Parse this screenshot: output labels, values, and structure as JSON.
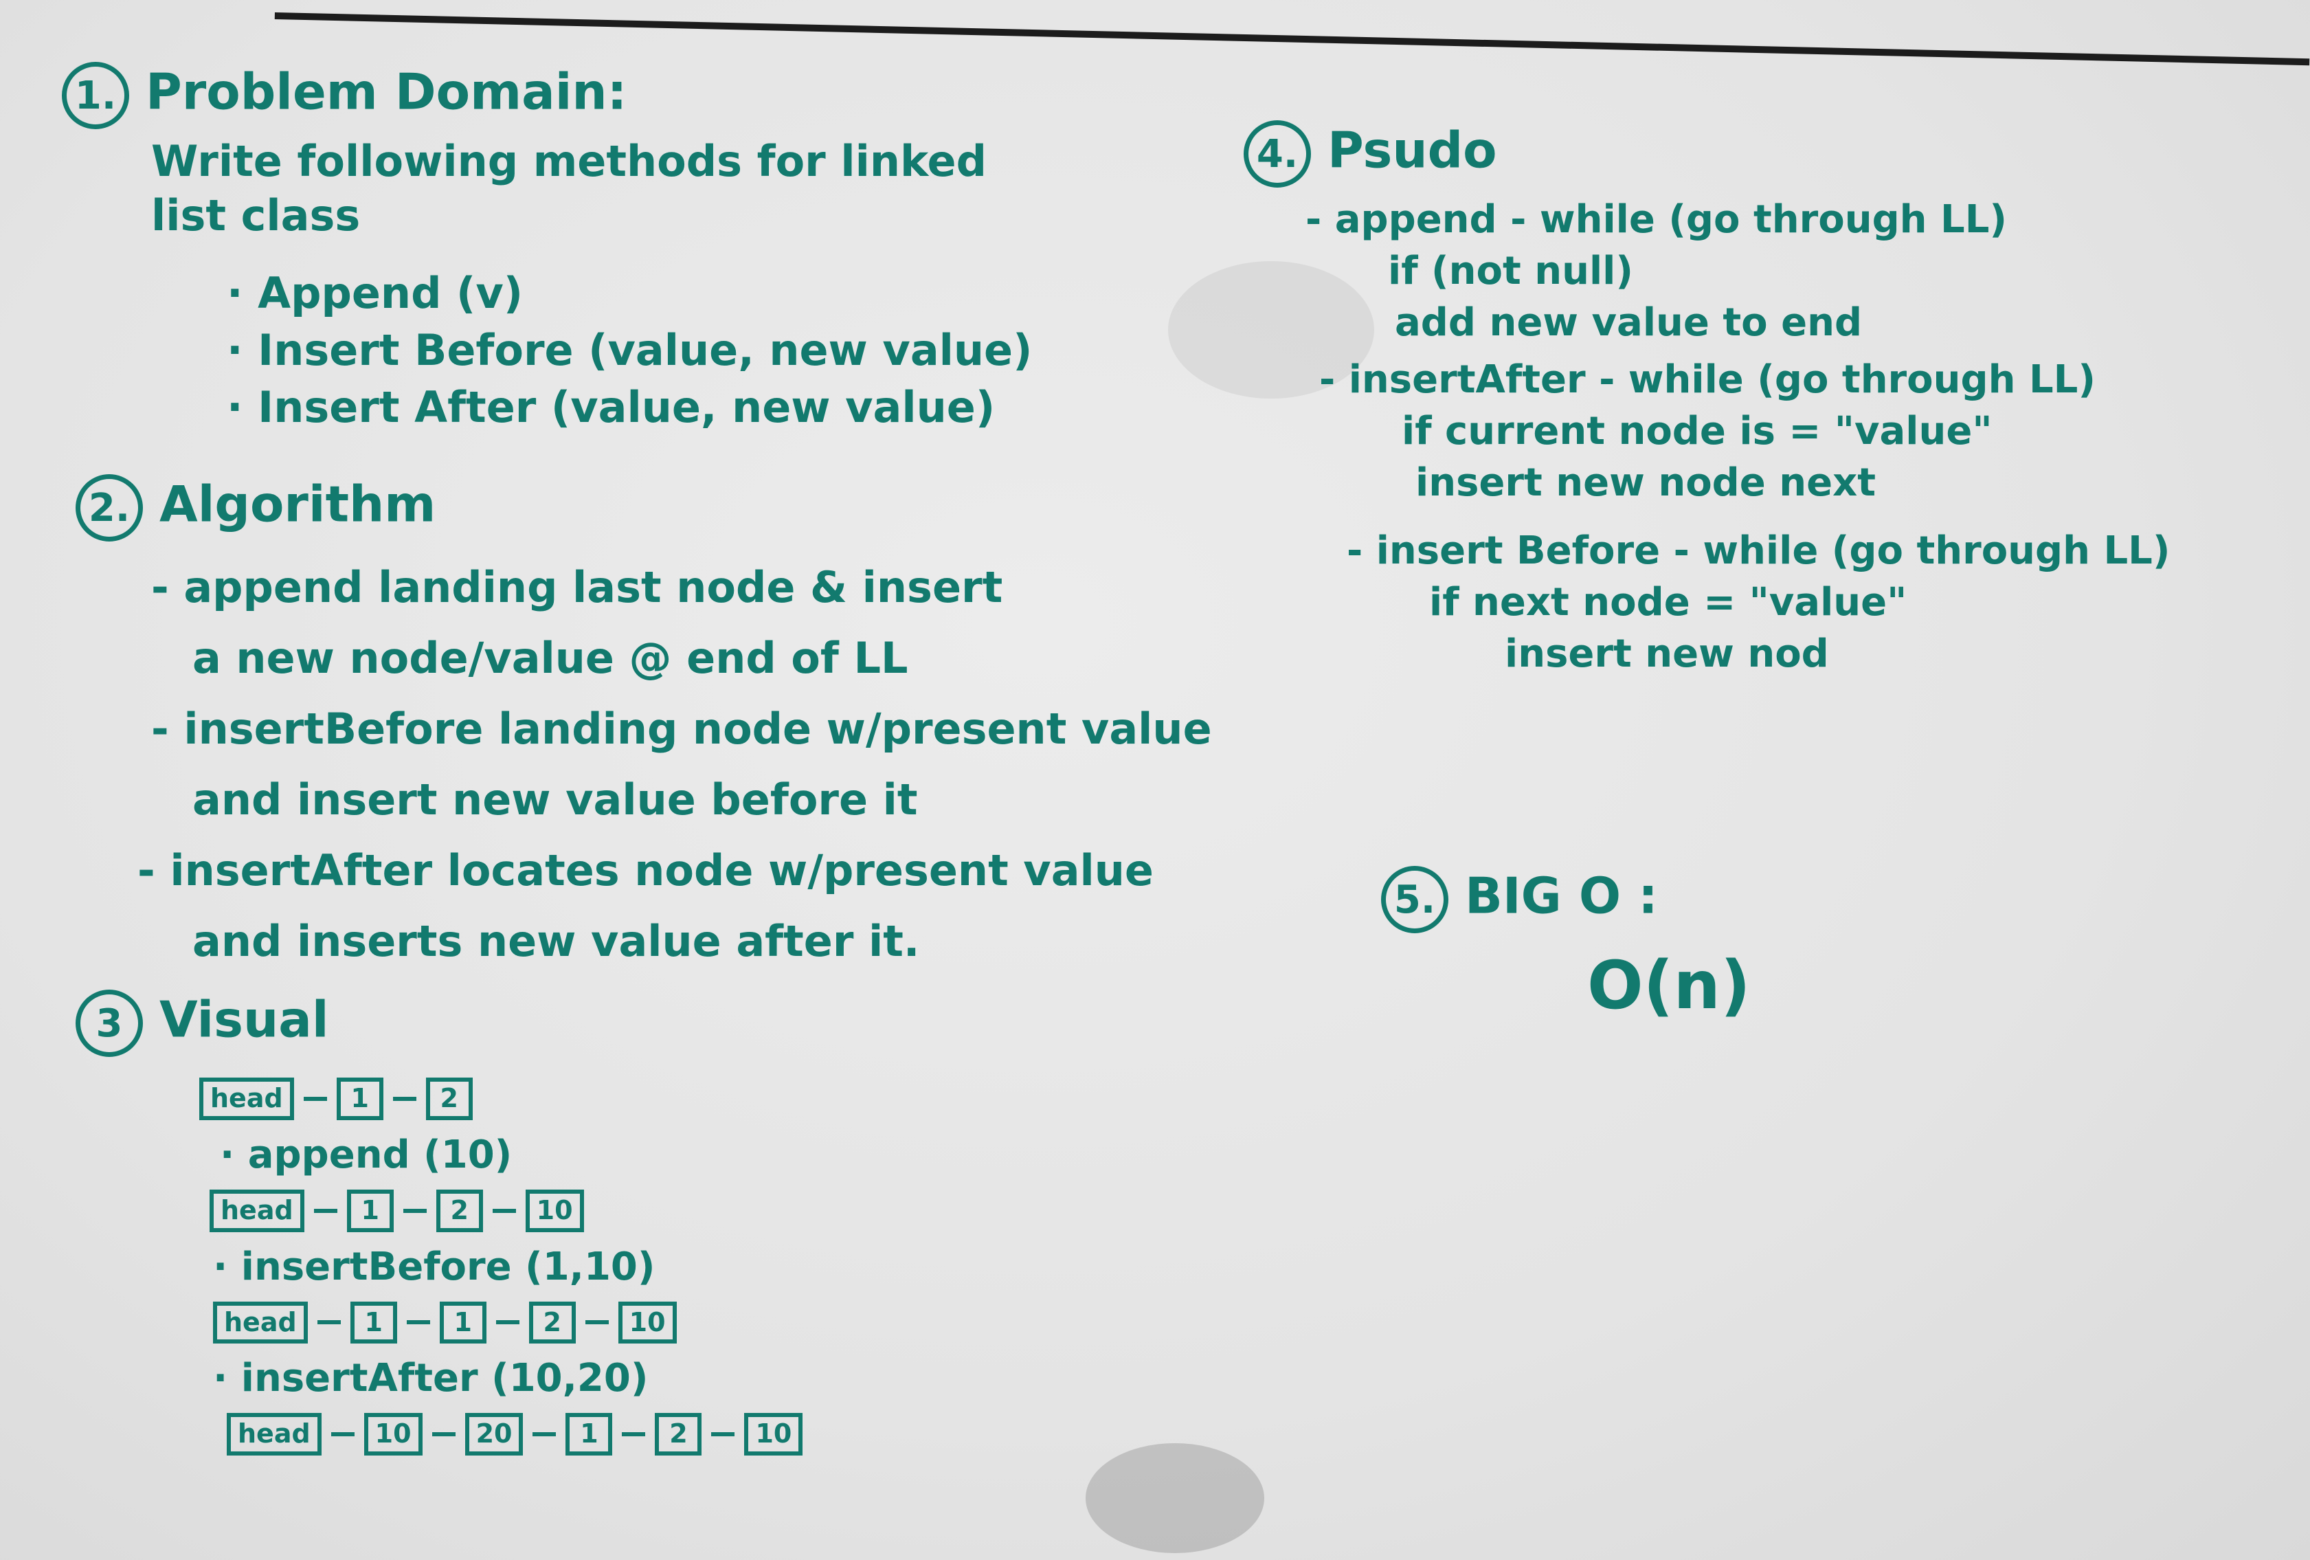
{
  "sections": {
    "problem": {
      "number": "1.",
      "title": "Problem Domain:",
      "lines": [
        "Write following methods for linked",
        "list class"
      ],
      "methods": [
        "· Append (v)",
        "· Insert Before (value, new value)",
        "· Insert After (value, new value)"
      ]
    },
    "algorithm": {
      "number": "2.",
      "title": "Algorithm",
      "lines": [
        "- append  landing last node & insert",
        "a new node/value @ end of LL",
        "- insertBefore  landing node w/present value",
        "and insert new value before it",
        "- insertAfter  locates node w/present value",
        "and inserts new value after it."
      ]
    },
    "visual": {
      "number": "3",
      "title": "Visual",
      "chains": [
        [
          "head",
          "1",
          "2"
        ],
        [
          "head",
          "1",
          "2",
          "10"
        ],
        [
          "head",
          "1",
          "1",
          "2",
          "10"
        ],
        [
          "head",
          "10",
          "20",
          "1",
          "2",
          "10"
        ]
      ],
      "ops": [
        "· append (10)",
        "· insertBefore (1,10)",
        "· insertAfter (10,20)"
      ]
    },
    "pseudo": {
      "number": "4.",
      "title": "Psudo",
      "lines": [
        "- append - while (go through LL)",
        "if (not null)",
        "add new value to end",
        "- insertAfter - while (go through LL)",
        "if current node is = \"value\"",
        "insert new node next",
        "- insert Before - while (go through LL)",
        "if next node = \"value\"",
        "insert new nod"
      ]
    },
    "bigo": {
      "number": "5.",
      "title": "BIG O :",
      "value": "O(n)"
    }
  },
  "colors": {
    "ink": "#127a6e",
    "board": "#e6e6e6"
  }
}
